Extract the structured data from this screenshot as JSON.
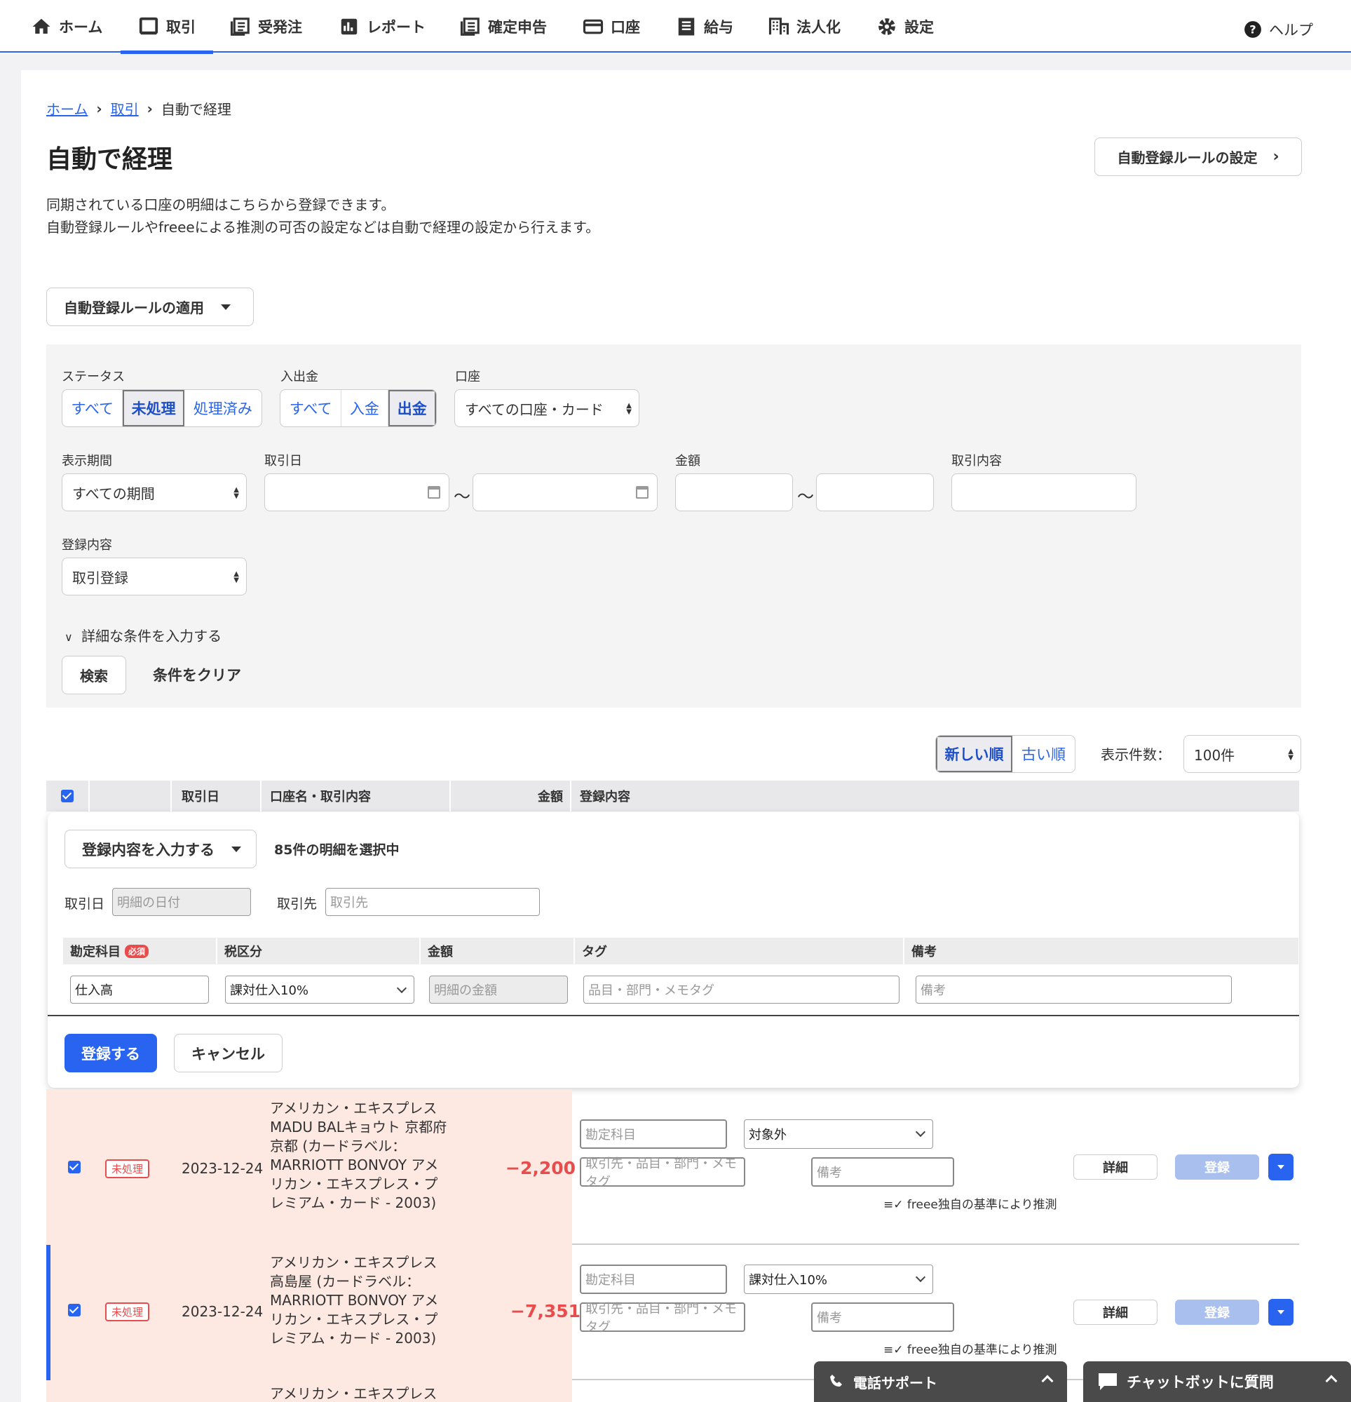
{
  "nav": {
    "items": [
      {
        "label": "ホーム",
        "icon": "home-icon"
      },
      {
        "label": "取引",
        "icon": "book-icon"
      },
      {
        "label": "受発注",
        "icon": "order-icon"
      },
      {
        "label": "レポート",
        "icon": "report-icon"
      },
      {
        "label": "確定申告",
        "icon": "document-icon"
      },
      {
        "label": "口座",
        "icon": "card-icon"
      },
      {
        "label": "給与",
        "icon": "payslip-icon"
      },
      {
        "label": "法人化",
        "icon": "building-icon"
      },
      {
        "label": "設定",
        "icon": "gear-icon"
      }
    ],
    "help": "ヘルプ"
  },
  "breadcrumb": {
    "home": "ホーム",
    "deals": "取引",
    "current": "自動で経理"
  },
  "page": {
    "title": "自動で経理",
    "rule_settings_button": "自動登録ルールの設定",
    "desc_line1": "同期されている口座の明細はこちらから登録できます。",
    "desc_line2": "自動登録ルールやfreeeによる推測の可否の設定などは自動で経理の設定から行えます。",
    "apply_rules_button": "自動登録ルールの適用"
  },
  "filter": {
    "status_label": "ステータス",
    "status_options": [
      "すべて",
      "未処理",
      "処理済み"
    ],
    "inout_label": "入出金",
    "inout_options": [
      "すべて",
      "入金",
      "出金"
    ],
    "account_label": "口座",
    "account_value": "すべての口座・カード",
    "period_label": "表示期間",
    "period_value": "すべての期間",
    "date_label": "取引日",
    "amount_label": "金額",
    "content_label": "取引内容",
    "reg_label": "登録内容",
    "reg_value": "取引登録",
    "tilde": "〜",
    "detail_toggle": "詳細な条件を入力する",
    "search_button": "検索",
    "clear_button": "条件をクリア"
  },
  "list": {
    "sort_new": "新しい順",
    "sort_old": "古い順",
    "perpage_label": "表示件数：",
    "perpage_value": "100件",
    "headers": {
      "date": "取引日",
      "account": "口座名・取引内容",
      "amount": "金額",
      "content": "登録内容"
    }
  },
  "bulk": {
    "input_button": "登録内容を入力する",
    "selected_text": "85件の明細を選択中",
    "date_label": "取引日",
    "date_placeholder": "明細の日付",
    "partner_label": "取引先",
    "partner_placeholder": "取引先",
    "col_account": "勘定科目",
    "required": "必須",
    "col_tax": "税区分",
    "col_amount": "金額",
    "col_tag": "タグ",
    "col_note": "備考",
    "account_value": "仕入高",
    "tax_value": "課対仕入10%",
    "amount_placeholder": "明細の金額",
    "tag_placeholder": "品目・部門・メモタグ",
    "note_placeholder": "備考",
    "register_button": "登録する",
    "cancel_button": "キャンセル"
  },
  "rows": [
    {
      "status": "未処理",
      "date": "2023-12-24",
      "desc": "アメリカン・エキスプレス MADU BALキョウト 京都府 京都 (カードラベル：MARRIOTT BONVOY アメリカン・エキスプレス・プレミアム・カード - 2003)",
      "amount": "−2,200",
      "account_placeholder": "勘定科目",
      "tax_value": "対象外",
      "tag_placeholder": "取引先・品目・部門・メモタグ",
      "note_placeholder": "備考",
      "detail": "詳細",
      "register": "登録",
      "guess": "freee独自の基準により推測"
    },
    {
      "status": "未処理",
      "date": "2023-12-24",
      "desc": "アメリカン・エキスプレス 高島屋 (カードラベル：MARRIOTT BONVOY アメリカン・エキスプレス・プレミアム・カード - 2003)",
      "amount": "−7,351",
      "account_placeholder": "勘定科目",
      "tax_value": "課対仕入10%",
      "tag_placeholder": "取引先・品目・部門・メモタグ",
      "note_placeholder": "備考",
      "detail": "詳細",
      "register": "登録",
      "guess": "freee独自の基準により推測"
    },
    {
      "desc": "アメリカン・エキスプレス"
    }
  ],
  "support": {
    "phone": "電話サポート",
    "chatbot": "チャットボットに質問"
  },
  "colors": {
    "accent": "#2864f0",
    "danger": "#e94c4c",
    "row_pink": "#fde9e2"
  }
}
